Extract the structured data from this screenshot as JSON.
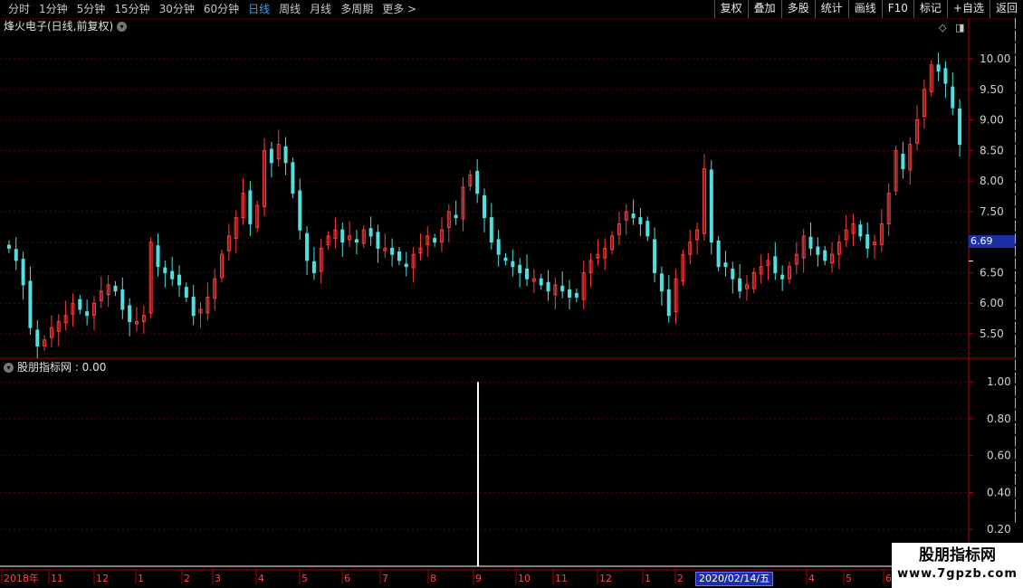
{
  "toolbar": {
    "periods": [
      "分时",
      "1分钟",
      "5分钟",
      "15分钟",
      "30分钟",
      "60分钟",
      "日线",
      "周线",
      "月线",
      "多周期",
      "更多 >"
    ],
    "active_period": "日线",
    "actions": [
      "复权",
      "叠加",
      "多股",
      "统计",
      "画线",
      "F10",
      "标记",
      "+自选",
      "返回"
    ]
  },
  "main": {
    "title": "烽火电子(日线,前复权)",
    "current_price_label": "6.69",
    "price_axis_ticks": [
      "10.00",
      "9.50",
      "9.00",
      "8.50",
      "8.00",
      "7.50",
      "7.00",
      "6.50",
      "6.00",
      "5.50"
    ],
    "top_icons": [
      "diamond-icon",
      "panel-toggle-icon"
    ]
  },
  "indicator": {
    "title": "股朋指标网 : 0.00",
    "axis_ticks": [
      "1.00",
      "0.80",
      "0.60",
      "0.40",
      "0.20"
    ]
  },
  "date_axis": {
    "labels": [
      "2018年",
      "11",
      "12",
      "1",
      "2",
      "3",
      "4",
      "5",
      "6",
      "7",
      "8",
      "9",
      "10",
      "11",
      "12",
      "1",
      "2",
      "3",
      "4",
      "5",
      "6",
      "7"
    ],
    "highlight_date": "2020/02/14/五"
  },
  "watermark": {
    "line1": "股朋指标网",
    "line2": "www.7gpzb.com"
  },
  "colors": {
    "up": "#ff3c3c",
    "down": "#4fe0e0",
    "grid": "#5a0000",
    "axis": "#b00000",
    "active_tab": "#2ea6e6",
    "badge": "#1a2fa8"
  },
  "chart_data": [
    {
      "type": "candlestick",
      "title": "烽火电子(日线,前复权)",
      "ylim": [
        5.1,
        10.4
      ],
      "current_price": 6.69,
      "series": [
        {
          "name": "close",
          "values": [
            6.9,
            6.7,
            6.3,
            5.6,
            5.3,
            5.4,
            5.6,
            5.7,
            5.8,
            6.0,
            5.9,
            5.8,
            6.0,
            6.2,
            6.3,
            6.2,
            5.9,
            5.7,
            5.7,
            5.8,
            7.0,
            6.6,
            6.5,
            6.4,
            6.3,
            6.1,
            5.8,
            5.9,
            6.1,
            6.4,
            6.8,
            7.1,
            7.4,
            7.8,
            7.3,
            7.6,
            8.5,
            8.3,
            8.6,
            8.3,
            7.8,
            7.2,
            6.7,
            6.5,
            6.9,
            7.1,
            7.2,
            7.0,
            7.1,
            7.0,
            7.2,
            7.1,
            6.9,
            6.9,
            6.8,
            6.7,
            6.6,
            6.8,
            6.9,
            7.1,
            7.0,
            7.2,
            7.5,
            7.4,
            7.9,
            8.1,
            7.8,
            7.4,
            7.0,
            6.8,
            6.7,
            6.6,
            6.5,
            6.4,
            6.4,
            6.3,
            6.2,
            6.3,
            6.2,
            6.1,
            6.1,
            6.5,
            6.7,
            6.8,
            6.9,
            7.1,
            7.3,
            7.5,
            7.4,
            7.3,
            7.1,
            6.5,
            6.2,
            5.8,
            6.4,
            6.8,
            7.0,
            7.2,
            8.2,
            7.0,
            6.6,
            6.6,
            6.4,
            6.2,
            6.3,
            6.5,
            6.6,
            6.7,
            6.5,
            6.4,
            6.6,
            6.8,
            7.1,
            6.9,
            6.8,
            6.7,
            6.8,
            7.0,
            7.2,
            7.3,
            7.1,
            6.9,
            7.0,
            7.3,
            7.8,
            8.5,
            8.2,
            8.6,
            9.0,
            9.5,
            9.9,
            9.8,
            9.6,
            9.2,
            8.6
          ]
        }
      ],
      "x_labels": [
        "2018年",
        "11",
        "12",
        "1",
        "2",
        "3",
        "4",
        "5",
        "6",
        "7",
        "8",
        "9",
        "10",
        "11",
        "12",
        "1",
        "2",
        "3",
        "4",
        "5",
        "6",
        "7"
      ]
    },
    {
      "type": "bar",
      "title": "股朋指标网",
      "ylim": [
        0,
        1.05
      ],
      "value_label": "0.00",
      "series": [
        {
          "name": "股朋指标网",
          "spike_at_label": "9",
          "spike_value": 1.0
        }
      ]
    }
  ]
}
